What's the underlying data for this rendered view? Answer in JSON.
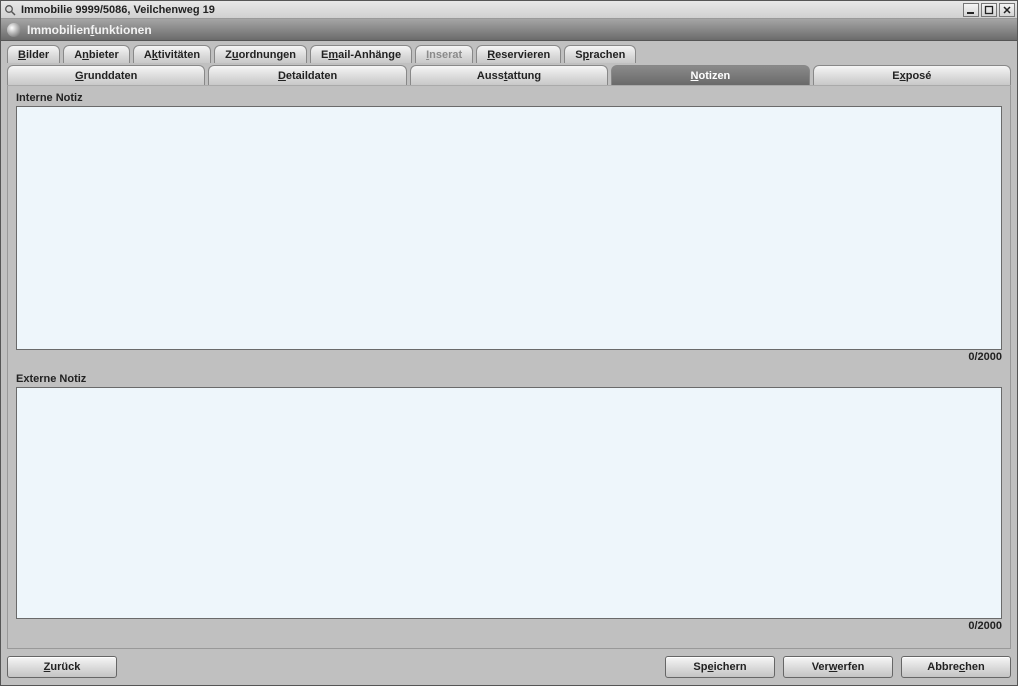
{
  "window": {
    "title": "Immobilie 9999/5086, Veilchenweg 19"
  },
  "funcbar": {
    "label_prefix": "Immobilien",
    "label_ul": "f",
    "label_suffix": "unktionen"
  },
  "tabs_row1": [
    {
      "prefix": "",
      "ul": "B",
      "suffix": "ilder",
      "name": "tab-bilder"
    },
    {
      "prefix": "A",
      "ul": "n",
      "suffix": "bieter",
      "name": "tab-anbieter"
    },
    {
      "prefix": "A",
      "ul": "k",
      "suffix": "tivitäten",
      "name": "tab-aktivitaeten"
    },
    {
      "prefix": "Z",
      "ul": "u",
      "suffix": "ordnungen",
      "name": "tab-zuordnungen"
    },
    {
      "prefix": "E",
      "ul": "m",
      "suffix": "ail-Anhänge",
      "name": "tab-email-anhaenge"
    },
    {
      "prefix": "",
      "ul": "I",
      "suffix": "nserat",
      "name": "tab-inserat",
      "disabled": true
    },
    {
      "prefix": "",
      "ul": "R",
      "suffix": "eservieren",
      "name": "tab-reservieren"
    },
    {
      "prefix": "S",
      "ul": "p",
      "suffix": "rachen",
      "name": "tab-sprachen"
    }
  ],
  "tabs_row2": [
    {
      "prefix": "",
      "ul": "G",
      "suffix": "runddaten",
      "name": "tab-grunddaten"
    },
    {
      "prefix": "",
      "ul": "D",
      "suffix": "etaildaten",
      "name": "tab-detaildaten"
    },
    {
      "prefix": "Auss",
      "ul": "t",
      "suffix": "attung",
      "name": "tab-ausstattung"
    },
    {
      "prefix": "",
      "ul": "N",
      "suffix": "otizen",
      "name": "tab-notizen",
      "active": true
    },
    {
      "prefix": "E",
      "ul": "x",
      "suffix": "posé",
      "name": "tab-expose"
    }
  ],
  "notes": {
    "internal_label": "Interne Notiz",
    "internal_value": "",
    "internal_counter": "0/2000",
    "external_label": "Externe Notiz",
    "external_value": "",
    "external_counter": "0/2000"
  },
  "buttons": {
    "back": {
      "prefix": "",
      "ul": "Z",
      "suffix": "urück"
    },
    "save": {
      "prefix": "Sp",
      "ul": "e",
      "suffix": "ichern"
    },
    "discard": {
      "prefix": "Ver",
      "ul": "w",
      "suffix": "erfen"
    },
    "cancel": {
      "prefix": "Abbre",
      "ul": "c",
      "suffix": "hen"
    }
  }
}
